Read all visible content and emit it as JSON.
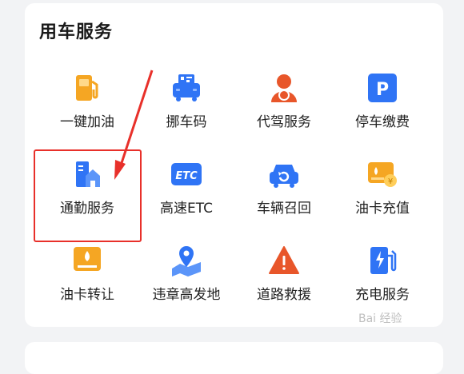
{
  "section": {
    "title": "用车服务"
  },
  "items": [
    {
      "label": "一键加油",
      "icon": "fuel-pump-icon"
    },
    {
      "label": "挪车码",
      "icon": "move-car-code-icon"
    },
    {
      "label": "代驾服务",
      "icon": "chauffeur-icon"
    },
    {
      "label": "停车缴费",
      "icon": "parking-icon"
    },
    {
      "label": "通勤服务",
      "icon": "commute-building-icon"
    },
    {
      "label": "高速ETC",
      "icon": "etc-icon"
    },
    {
      "label": "车辆召回",
      "icon": "car-recall-icon"
    },
    {
      "label": "油卡充值",
      "icon": "fuel-card-recharge-icon"
    },
    {
      "label": "油卡转让",
      "icon": "fuel-card-transfer-icon"
    },
    {
      "label": "违章高发地",
      "icon": "map-pin-icon"
    },
    {
      "label": "道路救援",
      "icon": "road-rescue-warning-icon"
    },
    {
      "label": "充电服务",
      "icon": "ev-charging-icon"
    }
  ],
  "etc_badge_text": "ETC",
  "parking_badge_text": "P",
  "colors": {
    "blue": "#2f74f5",
    "orange": "#f5a623",
    "red": "#e8302a"
  },
  "watermark": "Bai 经验"
}
